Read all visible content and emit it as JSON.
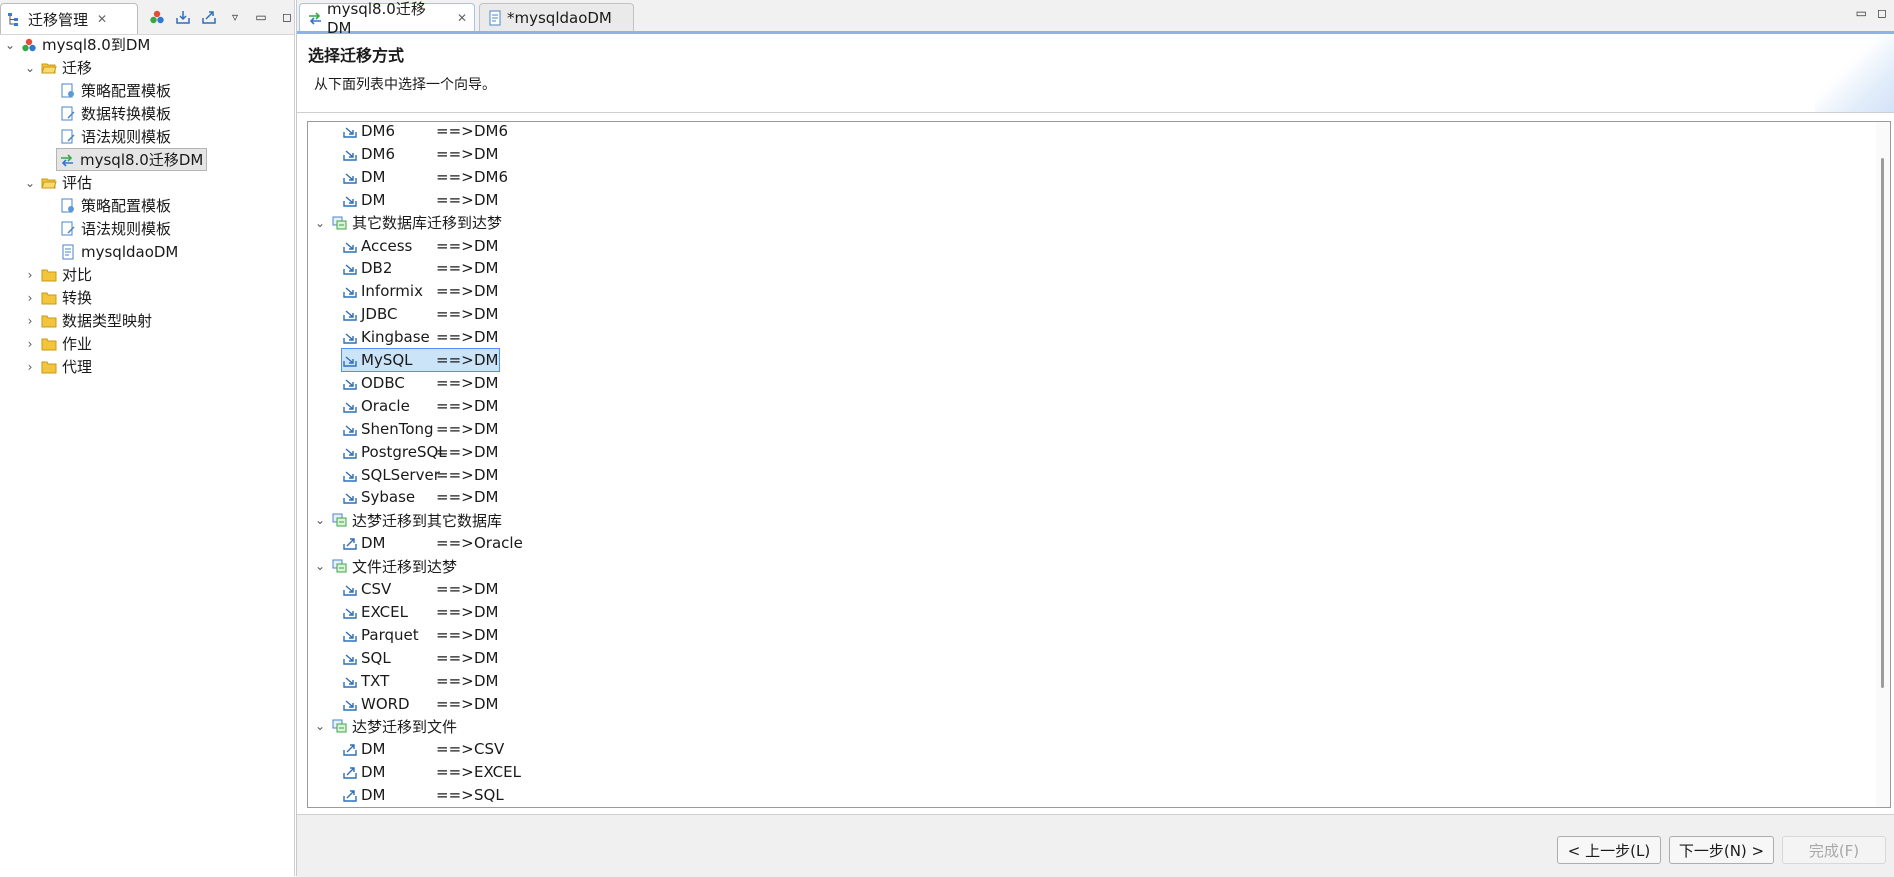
{
  "left_view": {
    "tab_title": "迁移管理",
    "tree": {
      "root": "mysql8.0到DM",
      "migrate": "迁移",
      "migrate_items": [
        "策略配置模板",
        "数据转换模板",
        "语法规则模板",
        "mysql8.0迁移DM"
      ],
      "assess": "评估",
      "assess_items": [
        "策略配置模板",
        "语法规则模板",
        "mysqldaoDM"
      ],
      "others": [
        "对比",
        "转换",
        "数据类型映射",
        "作业",
        "代理"
      ]
    }
  },
  "editor": {
    "tabs": [
      {
        "label": "mysql8.0迁移DM",
        "active": true
      },
      {
        "label": "*mysqldaoDM",
        "active": false
      }
    ],
    "wizard": {
      "title": "选择迁移方式",
      "description": "从下面列表中选择一个向导。"
    },
    "list": {
      "arrow": "==>",
      "group1_items": [
        {
          "from": "DM6",
          "to": "DM6"
        },
        {
          "from": "DM6",
          "to": "DM"
        },
        {
          "from": "DM",
          "to": "DM6"
        },
        {
          "from": "DM",
          "to": "DM"
        }
      ],
      "group2_label": "其它数据库迁移到达梦",
      "group2_items": [
        {
          "from": "Access",
          "to": "DM"
        },
        {
          "from": "DB2",
          "to": "DM"
        },
        {
          "from": "Informix",
          "to": "DM"
        },
        {
          "from": "JDBC",
          "to": "DM"
        },
        {
          "from": "Kingbase",
          "to": "DM"
        },
        {
          "from": "MySQL",
          "to": "DM"
        },
        {
          "from": "ODBC",
          "to": "DM"
        },
        {
          "from": "Oracle",
          "to": "DM"
        },
        {
          "from": "ShenTong",
          "to": "DM"
        },
        {
          "from": "PostgreSQL",
          "to": "DM"
        },
        {
          "from": "SQLServer",
          "to": "DM"
        },
        {
          "from": "Sybase",
          "to": "DM"
        }
      ],
      "group3_label": "达梦迁移到其它数据库",
      "group3_items": [
        {
          "from": "DM",
          "to": "Oracle"
        }
      ],
      "group4_label": "文件迁移到达梦",
      "group4_items": [
        {
          "from": "CSV",
          "to": "DM"
        },
        {
          "from": "EXCEL",
          "to": "DM"
        },
        {
          "from": "Parquet",
          "to": "DM"
        },
        {
          "from": "SQL",
          "to": "DM"
        },
        {
          "from": "TXT",
          "to": "DM"
        },
        {
          "from": "WORD",
          "to": "DM"
        }
      ],
      "group5_label": "达梦迁移到文件",
      "group5_items": [
        {
          "from": "DM",
          "to": "CSV"
        },
        {
          "from": "DM",
          "to": "EXCEL"
        },
        {
          "from": "DM",
          "to": "SQL"
        }
      ]
    },
    "buttons": {
      "back": "< 上一步(L)",
      "next": "下一步(N) >",
      "finish": "完成(F)"
    }
  }
}
